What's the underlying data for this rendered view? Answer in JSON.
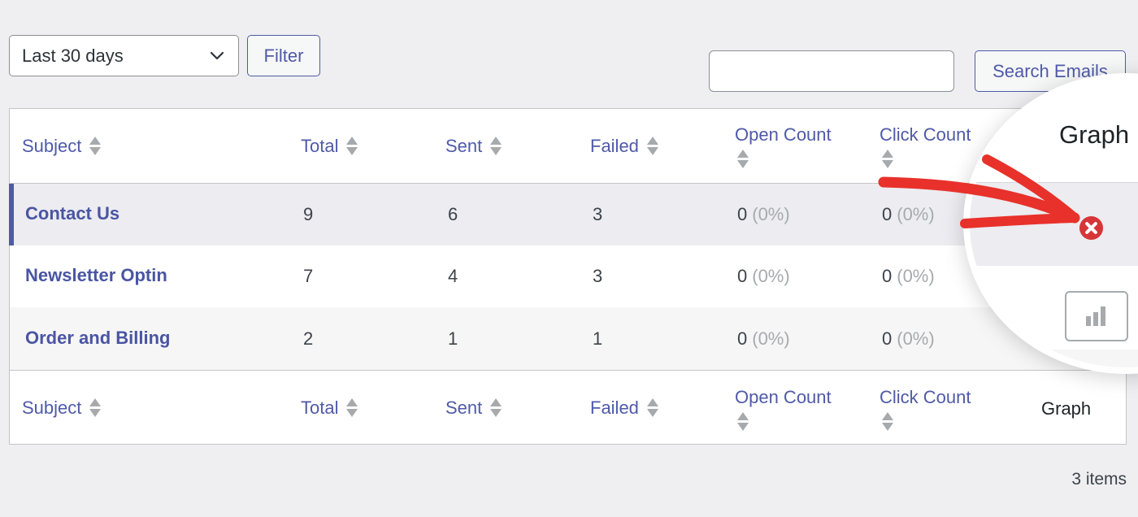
{
  "filters": {
    "date_range": "Last 30 days",
    "filter_label": "Filter"
  },
  "search": {
    "value": "",
    "placeholder": "",
    "button_label": "Search Emails"
  },
  "table": {
    "columns": [
      {
        "label": "Subject",
        "sortable": true
      },
      {
        "label": "Total",
        "sortable": true
      },
      {
        "label": "Sent",
        "sortable": true
      },
      {
        "label": "Failed",
        "sortable": true
      },
      {
        "label": "Open Count",
        "sortable": true
      },
      {
        "label": "Click Count",
        "sortable": true
      },
      {
        "label": "Graph",
        "sortable": false
      }
    ],
    "rows": [
      {
        "subject": "Contact Us",
        "total": "9",
        "sent": "6",
        "failed": "3",
        "open_count": "0",
        "open_pct": "(0%)",
        "click_count": "0",
        "click_pct": "(0%)",
        "graph": "error-icon",
        "active": true
      },
      {
        "subject": "Newsletter Optin",
        "total": "7",
        "sent": "4",
        "failed": "3",
        "open_count": "0",
        "open_pct": "(0%)",
        "click_count": "0",
        "click_pct": "(0%)",
        "graph": "bar-chart-button"
      },
      {
        "subject": "Order and Billing",
        "total": "2",
        "sent": "1",
        "failed": "1",
        "open_count": "0",
        "open_pct": "(0%)",
        "click_count": "0",
        "click_pct": "(0%)",
        "graph": ""
      }
    ]
  },
  "pagination": {
    "items_count": "3 items"
  },
  "annotation": {
    "magnifier_title": "Graph",
    "arrow_color": "#e8312a",
    "error_icon_color": "#d63638",
    "accent_color": "#4f5aa8"
  }
}
